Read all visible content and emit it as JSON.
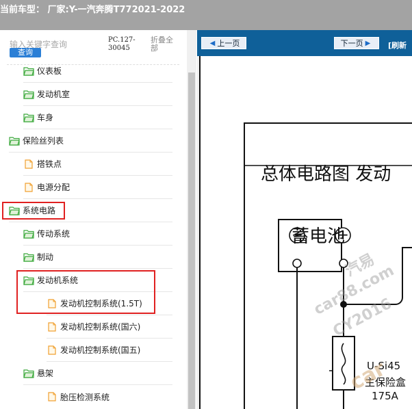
{
  "titlebar": {
    "text": "当前车型： 厂家:Y-一汽奔腾T772021-2022"
  },
  "left": {
    "search_placeholder": "输入关键字查询",
    "query_label": "查询",
    "pc_code": "PC.127-30045",
    "collapse_all": "折叠全部",
    "tree": [
      {
        "label": "仪表板",
        "icon": "folder-open-icon"
      },
      {
        "label": "发动机室",
        "icon": "folder-open-icon"
      },
      {
        "label": "车身",
        "icon": "folder-open-icon"
      },
      {
        "label": "保险丝列表",
        "icon": "folder-open-icon"
      },
      {
        "label": "搭铁点",
        "icon": "document-icon"
      },
      {
        "label": "电源分配",
        "icon": "document-icon"
      },
      {
        "label": "系统电路",
        "icon": "folder-open-icon"
      },
      {
        "label": "传动系统",
        "icon": "folder-open-icon"
      },
      {
        "label": "制动",
        "icon": "folder-open-icon"
      },
      {
        "label": "发动机系统",
        "icon": "folder-open-icon"
      },
      {
        "label": "发动机控制系统(1.5T)",
        "icon": "document-icon"
      },
      {
        "label": "发动机控制系统(国六)",
        "icon": "document-icon"
      },
      {
        "label": "发动机控制系统(国五)",
        "icon": "document-icon"
      },
      {
        "label": "悬架",
        "icon": "folder-open-icon"
      },
      {
        "label": "胎压检测系统",
        "icon": "document-icon"
      }
    ]
  },
  "viewer": {
    "prev_page": "上一页",
    "next_page": "下一页",
    "refresh": "[刷新",
    "diagram_title": "总体电路图  发动",
    "battery_label": "蓄电池",
    "minus_symbol": "−",
    "plus_symbol": "+",
    "fuse_code": "U-Si45",
    "fuse_name": "主保险盒",
    "fuse_amp": "175A",
    "watermarks": [
      "汽易",
      "car88.com",
      "CY2016",
      "car"
    ]
  },
  "colors": {
    "titlebar_bg": "#a3a3a3",
    "toolbar_bg": "#0f6099",
    "query_btn": "#2b7fd6",
    "folder_green": "#3aa83a",
    "document_orange": "#f0a030",
    "highlight_red": "#e02020"
  }
}
